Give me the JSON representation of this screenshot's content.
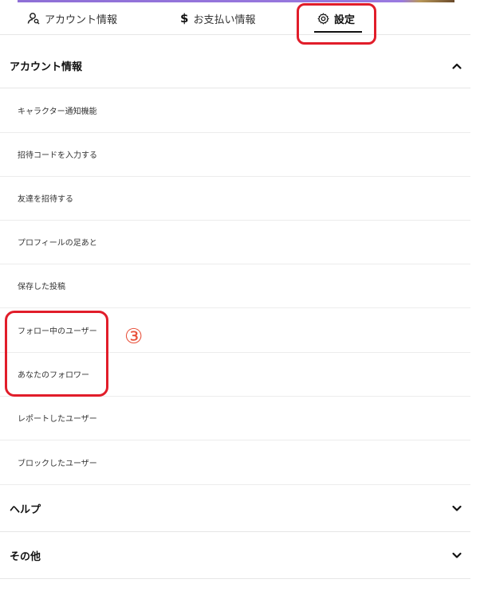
{
  "tabs": [
    {
      "label": "アカウント情報",
      "icon": "user-search-icon"
    },
    {
      "label": "お支払い情報",
      "icon": "dollar-icon"
    },
    {
      "label": "設定",
      "icon": "gear-icon",
      "active": true
    }
  ],
  "sections": {
    "account": {
      "title": "アカウント情報",
      "expanded": true,
      "items": [
        "キャラクター通知機能",
        "招待コードを入力する",
        "友達を招待する",
        "プロフィールの足あと",
        "保存した投稿",
        "フォロー中のユーザー",
        "あなたのフォロワー",
        "レポートしたユーザー",
        "ブロックしたユーザー"
      ]
    },
    "help": {
      "title": "ヘルプ",
      "expanded": false
    },
    "other": {
      "title": "その他",
      "expanded": false
    }
  },
  "annotation": {
    "marker": "③",
    "color": "#e8503a"
  },
  "colors": {
    "highlight": "#e11d2a",
    "accent": "#9a7ae0"
  }
}
